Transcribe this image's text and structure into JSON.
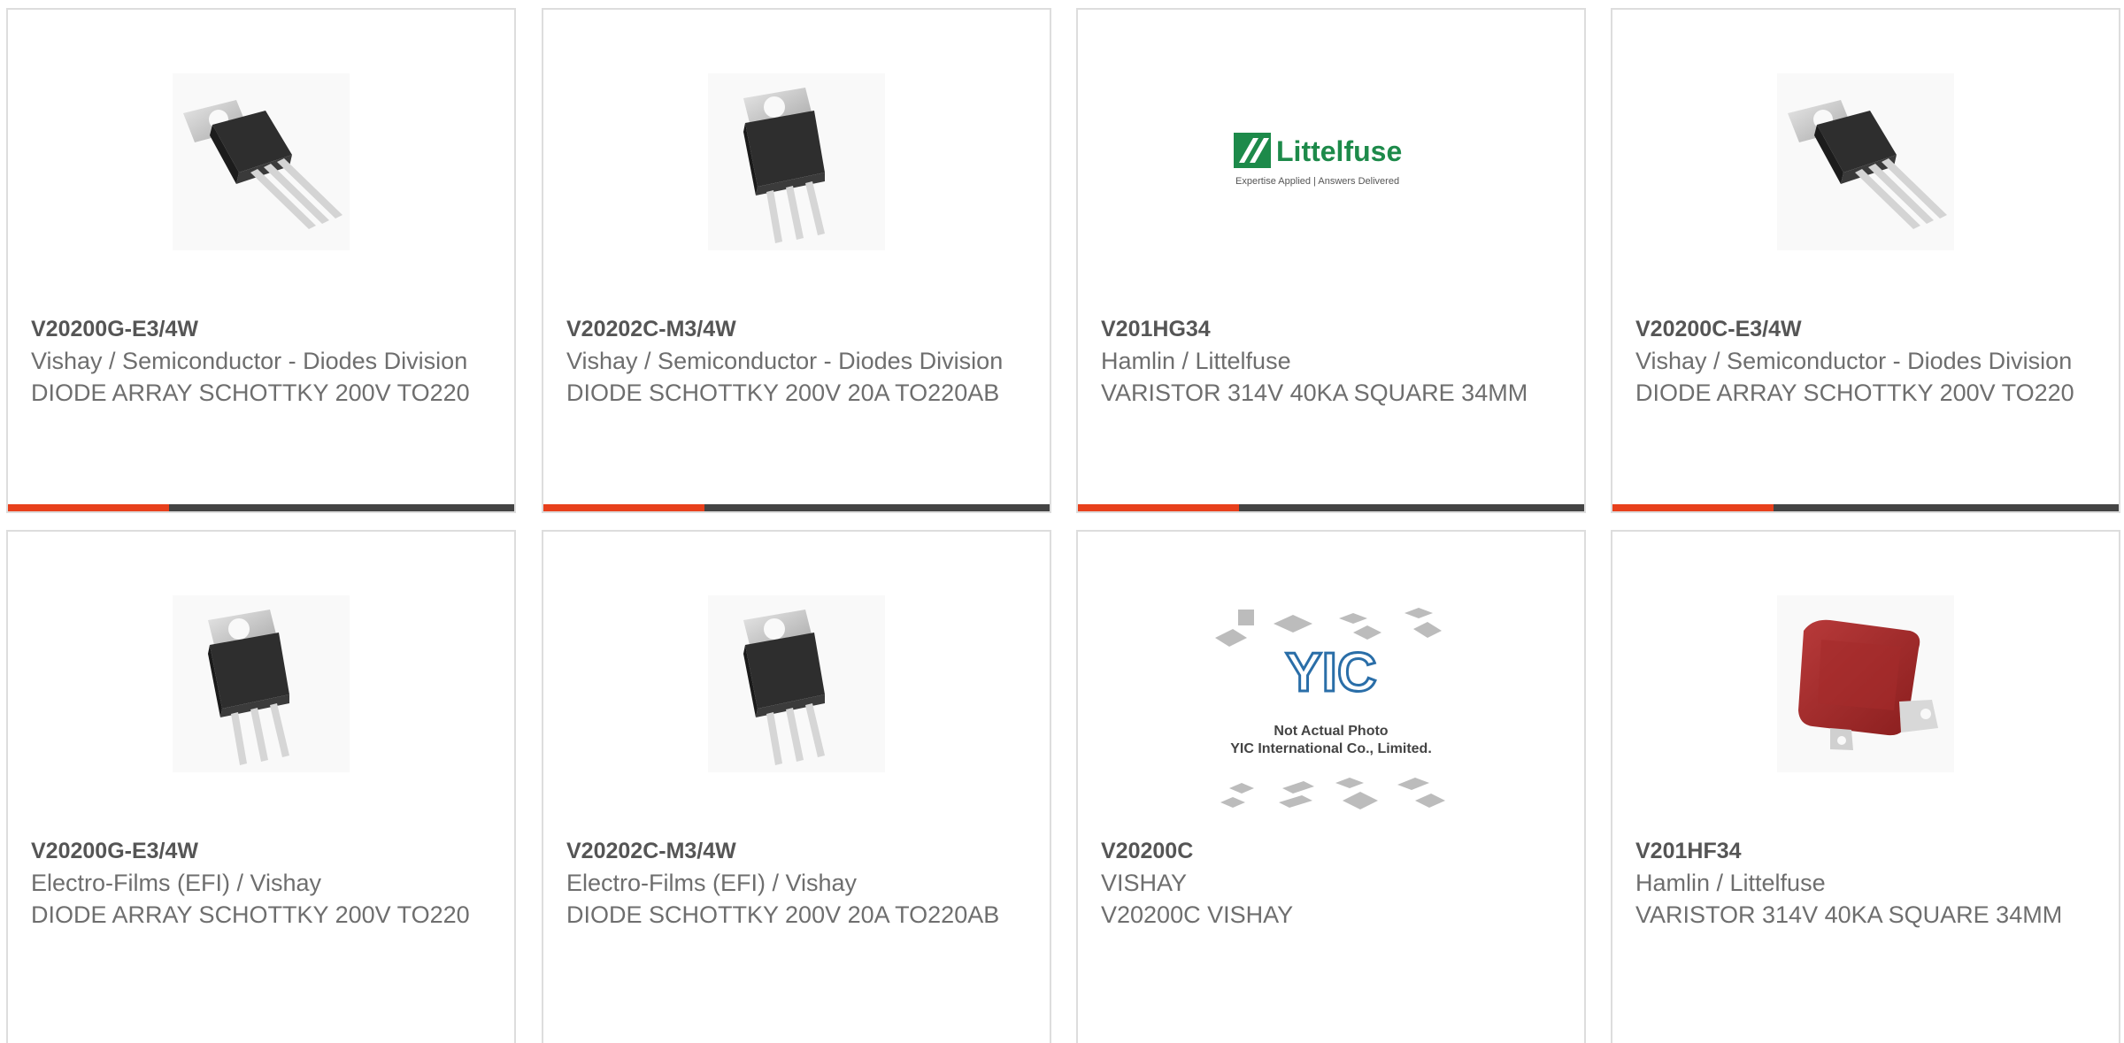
{
  "accent_color": "#e8401c",
  "products": [
    {
      "part": "V20200G-E3/4W",
      "manufacturer": "Vishay / Semiconductor - Diodes Division",
      "description": "DIODE ARRAY SCHOTTKY 200V TO220",
      "image_icon": "to220-tilted-image"
    },
    {
      "part": "V20202C-M3/4W",
      "manufacturer": "Vishay / Semiconductor - Diodes Division",
      "description": "DIODE SCHOTTKY 200V 20A TO220AB",
      "image_icon": "to220-upright-image"
    },
    {
      "part": "V201HG34",
      "manufacturer": "Hamlin / Littelfuse",
      "description": "VARISTOR 314V 40KA SQUARE 34MM",
      "image_icon": "littelfuse-logo",
      "logo": {
        "brand": "Littelfuse",
        "tagline": "Expertise Applied | Answers Delivered"
      }
    },
    {
      "part": "V20200C-E3/4W",
      "manufacturer": "Vishay / Semiconductor - Diodes Division",
      "description": "DIODE ARRAY SCHOTTKY 200V TO220",
      "image_icon": "to220-tilted-image"
    },
    {
      "part": "V20200G-E3/4W",
      "manufacturer": "Electro-Films (EFI) / Vishay",
      "description": "DIODE ARRAY SCHOTTKY 200V TO220",
      "image_icon": "to220-upright-image"
    },
    {
      "part": "V20202C-M3/4W",
      "manufacturer": "Electro-Films (EFI) / Vishay",
      "description": "DIODE SCHOTTKY 200V 20A TO220AB",
      "image_icon": "to220-upright-image"
    },
    {
      "part": "V20200C",
      "manufacturer": "VISHAY",
      "description": "V20200C VISHAY",
      "image_icon": "yic-placeholder-image",
      "placeholder": {
        "logo": "YIC",
        "line1": "Not Actual Photo",
        "line2": "YIC International Co., Limited."
      }
    },
    {
      "part": "V201HF34",
      "manufacturer": "Hamlin / Littelfuse",
      "description": "VARISTOR 314V 40KA SQUARE 34MM",
      "image_icon": "red-varistor-image"
    }
  ]
}
